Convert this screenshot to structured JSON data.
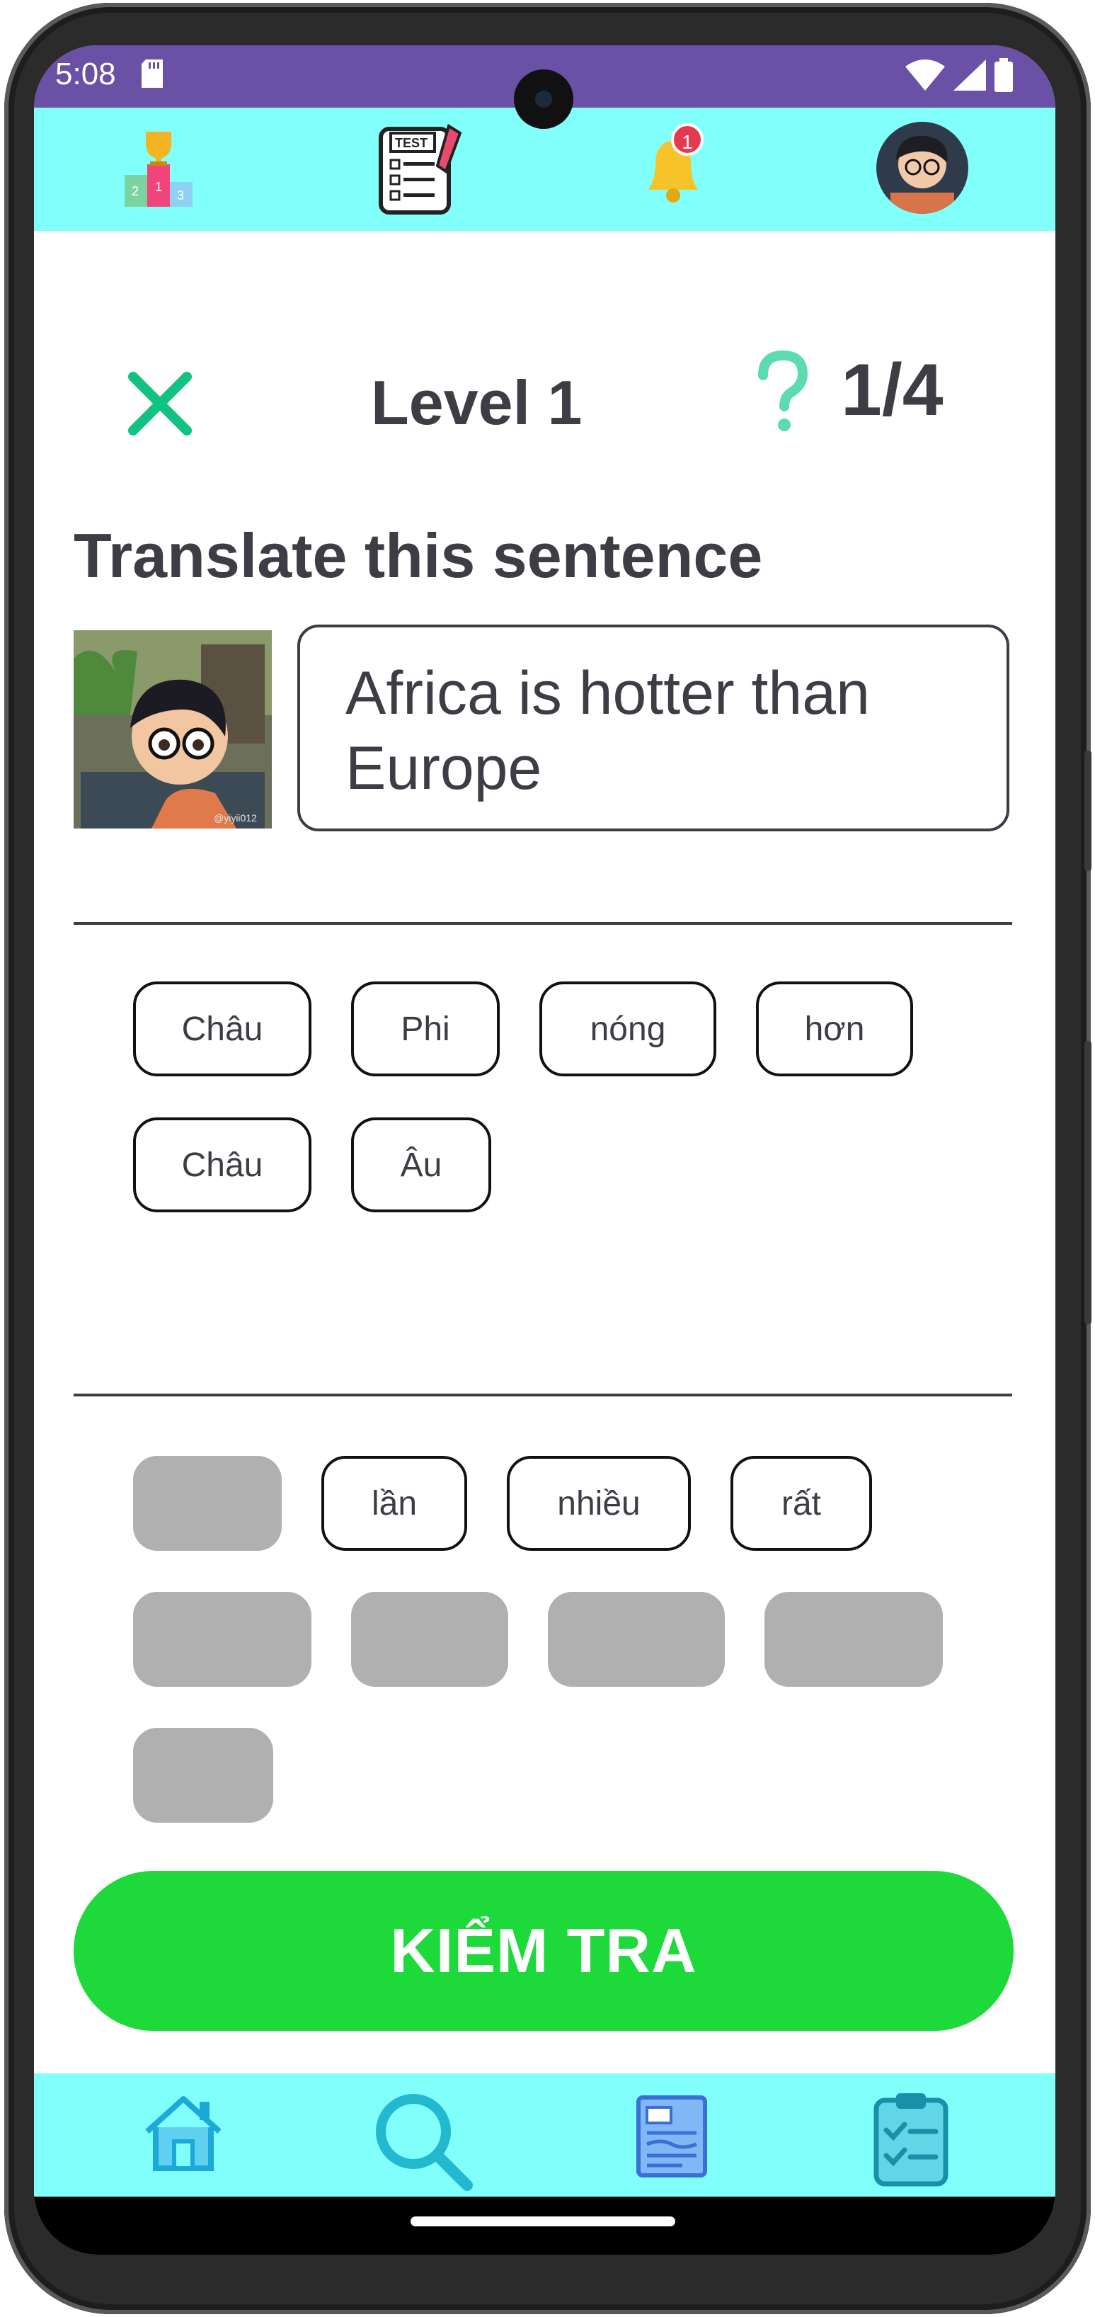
{
  "status_bar": {
    "time": "5:08",
    "background": "#6a51a6"
  },
  "top_bar": {
    "background": "#80fffb",
    "icons": [
      "leaderboard-icon",
      "test-icon",
      "notification-bell-icon",
      "avatar"
    ],
    "notification_count": "1",
    "test_icon_label": "TEST"
  },
  "lesson": {
    "level_title": "Level 1",
    "progress": "1/4",
    "instruction": "Translate this sentence",
    "source_sentence": "Africa is hotter than Europe",
    "image_watermark": "@yiyii012"
  },
  "answer_chips": [
    "Châu",
    "Phi",
    "nóng",
    "hơn",
    "Châu",
    "Âu"
  ],
  "word_bank": {
    "visible_words": [
      "lần",
      "nhiều",
      "rất"
    ],
    "used_slots_count": 6
  },
  "check_button": {
    "label": "KIỂM TRA",
    "color": "#1ed93a"
  },
  "bottom_nav": {
    "background": "#80fffb",
    "items": [
      "home-icon",
      "search-icon",
      "document-icon",
      "clipboard-checklist-icon"
    ]
  }
}
